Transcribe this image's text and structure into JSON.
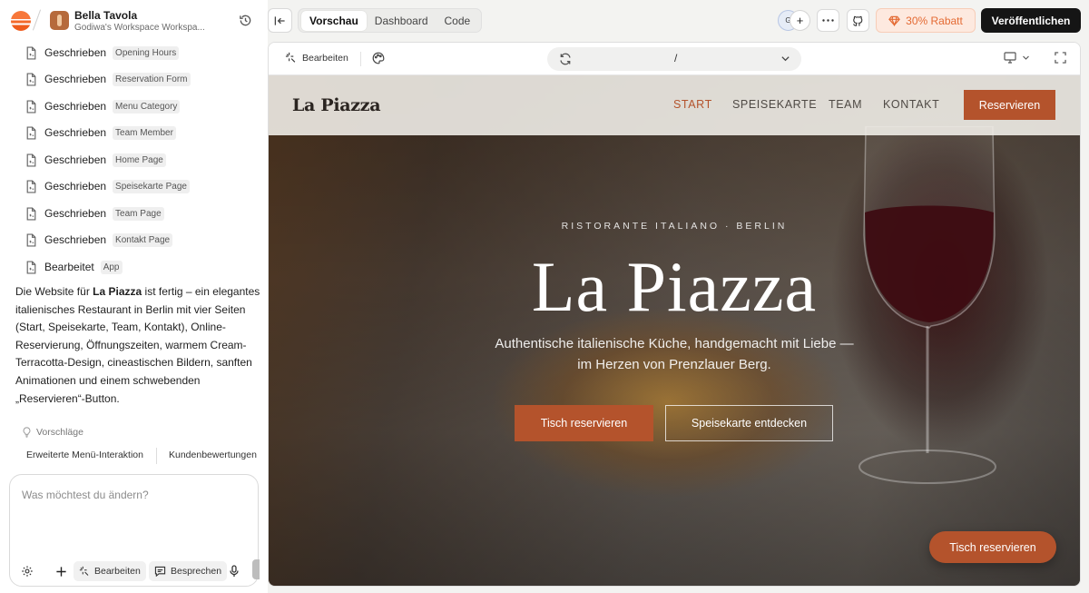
{
  "project": {
    "title": "Bella Tavola",
    "workspace": "Godiwa's Workspace Workspa..."
  },
  "files": [
    {
      "status": "Geschrieben",
      "name": "Opening Hours"
    },
    {
      "status": "Geschrieben",
      "name": "Reservation Form"
    },
    {
      "status": "Geschrieben",
      "name": "Menu Category"
    },
    {
      "status": "Geschrieben",
      "name": "Team Member"
    },
    {
      "status": "Geschrieben",
      "name": "Home Page"
    },
    {
      "status": "Geschrieben",
      "name": "Speisekarte Page"
    },
    {
      "status": "Geschrieben",
      "name": "Team Page"
    },
    {
      "status": "Geschrieben",
      "name": "Kontakt Page"
    },
    {
      "status": "Bearbeitet",
      "name": "App"
    }
  ],
  "summary": {
    "before": "Die Website für ",
    "bold": "La Piazza",
    "after": " ist fertig – ein elegantes italienisches Restaurant in Berlin mit vier Seiten (Start, Speisekarte, Team, Kontakt), Online-Reservierung, Öffnungszeiten, warmem Cream-Terracotta-Design, cineastischen Bildern, sanften Animationen und einem schwebenden „Reservieren“-Button."
  },
  "suggestions": {
    "label": "Vorschläge",
    "items": [
      "Erweiterte Menü-Interaktion",
      "Kundenbewertungen"
    ]
  },
  "composer": {
    "placeholder": "Was möchtest du ändern?",
    "edit_label": "Bearbeiten",
    "discuss_label": "Besprechen"
  },
  "topbar": {
    "tabs": [
      "Vorschau",
      "Dashboard",
      "Code"
    ],
    "active_tab": "Vorschau",
    "collaborator_initial": "G",
    "promo": "30% Rabatt",
    "publish": "Veröffentlichen"
  },
  "preview": {
    "edit_label": "Bearbeiten",
    "url": "/"
  },
  "site": {
    "brand": "La Piazza",
    "nav": [
      "START",
      "SPEISEKARTE",
      "TEAM",
      "KONTAKT"
    ],
    "nav_active": "START",
    "nav_cta": "Reservieren",
    "kicker": "RISTORANTE ITALIANO · BERLIN",
    "title": "La Piazza",
    "subtitle": "Authentische italienische Küche, handgemacht mit Liebe — im Herzen von Prenzlauer Berg.",
    "primary_cta": "Tisch reservieren",
    "secondary_cta": "Speisekarte entdecken",
    "floating_cta": "Tisch reservieren"
  },
  "colors": {
    "accent": "#b4532c",
    "publish_bg": "#151515",
    "promo_text": "#e46a33",
    "promo_bg": "#fde9df"
  },
  "icons": [
    "app-logo-icon",
    "history-icon",
    "file-icon",
    "bulb-icon",
    "settings-icon",
    "plus-icon",
    "sparkle-icon",
    "chat-icon",
    "mic-icon",
    "collapse-panel-icon",
    "more-icon",
    "github-icon",
    "gem-icon",
    "palette-icon",
    "refresh-icon",
    "chevron-down-icon",
    "monitor-icon",
    "fullscreen-icon"
  ]
}
